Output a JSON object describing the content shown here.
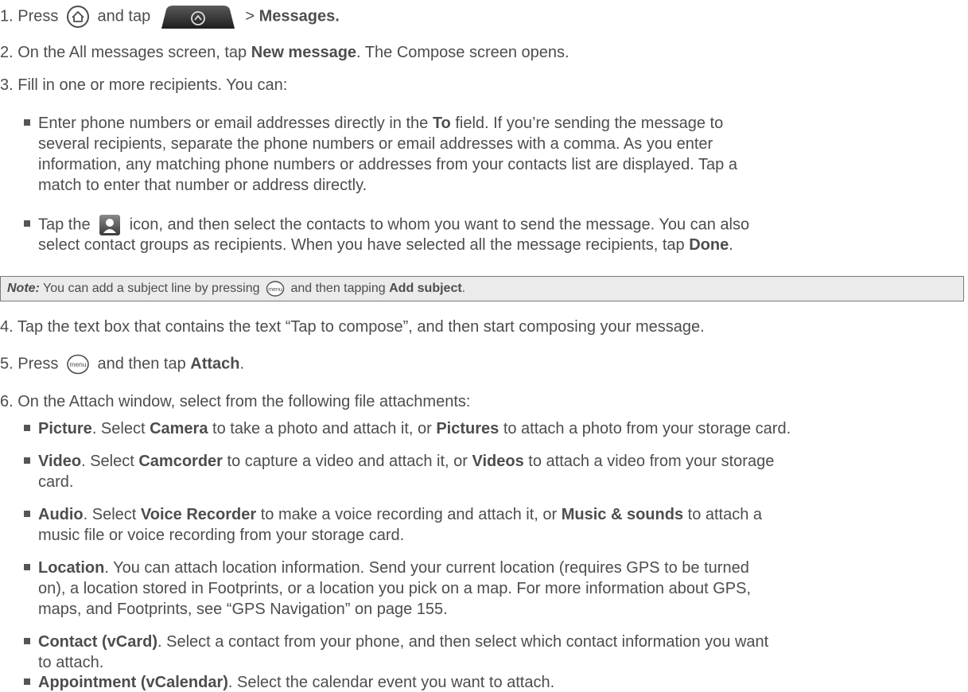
{
  "steps": [
    {
      "num": "1.",
      "a": "Press",
      "b": "and tap",
      "c": "> ",
      "c_bold": "Messages."
    },
    {
      "num": "2.",
      "a": "On the All messages screen, tap ",
      "a_bold": "New message",
      "b": ". The Compose screen opens."
    },
    {
      "num": "3.",
      "a": "Fill in one or more recipients. You can:"
    },
    {
      "num": "4.",
      "a": "Tap the text box that contains the text “Tap to compose”, and then start composing your message."
    },
    {
      "num": "5.",
      "a": "Press",
      "b": "and then tap ",
      "b_bold": "Attach",
      "c": "."
    },
    {
      "num": "6.",
      "a": "On the Attach window, select from the following file attachments:"
    }
  ],
  "recipient_bullets": {
    "b1_l1_a": "Enter phone numbers or email addresses directly in the ",
    "b1_l1_bold": "To",
    "b1_l1_b": " field. If you’re sending the message to",
    "b1_l2": "several recipients, separate the phone numbers or email addresses with a comma. As you enter",
    "b1_l3": "information, any matching phone numbers or addresses from your contacts list are displayed. Tap a",
    "b1_l4": "match to enter that number or address directly.",
    "b2_l1_a": "Tap the",
    "b2_l1_b": "icon, and then select the contacts to whom you want to send the message. You can also",
    "b2_l2_a": "select contact groups as recipients. When you have selected all the message recipients, tap ",
    "b2_l2_bold": "Done",
    "b2_l2_b": "."
  },
  "note": {
    "label": "Note:",
    "a": "You can add a subject line by pressing",
    "b": "and then tapping ",
    "bold": "Add subject",
    "c": "."
  },
  "attachments": {
    "pic_bold": "Picture",
    "pic_a": ". Select ",
    "pic_b_bold": "Camera",
    "pic_c": " to take a photo and attach it, or ",
    "pic_d_bold": "Pictures",
    "pic_e": " to attach a photo from your storage card.",
    "vid_bold": "Video",
    "vid_a": ". Select ",
    "vid_b_bold": "Camcorder",
    "vid_c": " to capture a video and attach it, or ",
    "vid_d_bold": "Videos",
    "vid_e": " to attach a video from your storage",
    "vid_l2": "card.",
    "aud_bold": "Audio",
    "aud_a": ". Select ",
    "aud_b_bold": "Voice Recorder",
    "aud_c": " to make a voice recording and attach it, or ",
    "aud_d_bold": "Music & sounds",
    "aud_e": " to attach a",
    "aud_l2": "music file or voice recording from your storage card.",
    "loc_bold": "Location",
    "loc_a": ". You can attach location information. Send your current location (requires GPS to be turned",
    "loc_l2": "on), a location stored in Footprints, or a location you pick on a map. For more information about GPS,",
    "loc_l3": "maps, and Footprints, see “GPS Navigation” on page 155.",
    "con_bold": "Contact (vCard)",
    "con_a": ". Select a contact from your phone, and then select which contact information you want",
    "con_l2": "to attach.",
    "app_bold": "Appointment (vCalendar)",
    "app_a": ". Select the calendar event you want to attach."
  },
  "icons": {
    "home": "home-button-icon",
    "all_apps": "all-apps-tab-icon",
    "menu": "menu-button-icon",
    "contacts": "contacts-picker-icon",
    "menu_label": "menu"
  }
}
